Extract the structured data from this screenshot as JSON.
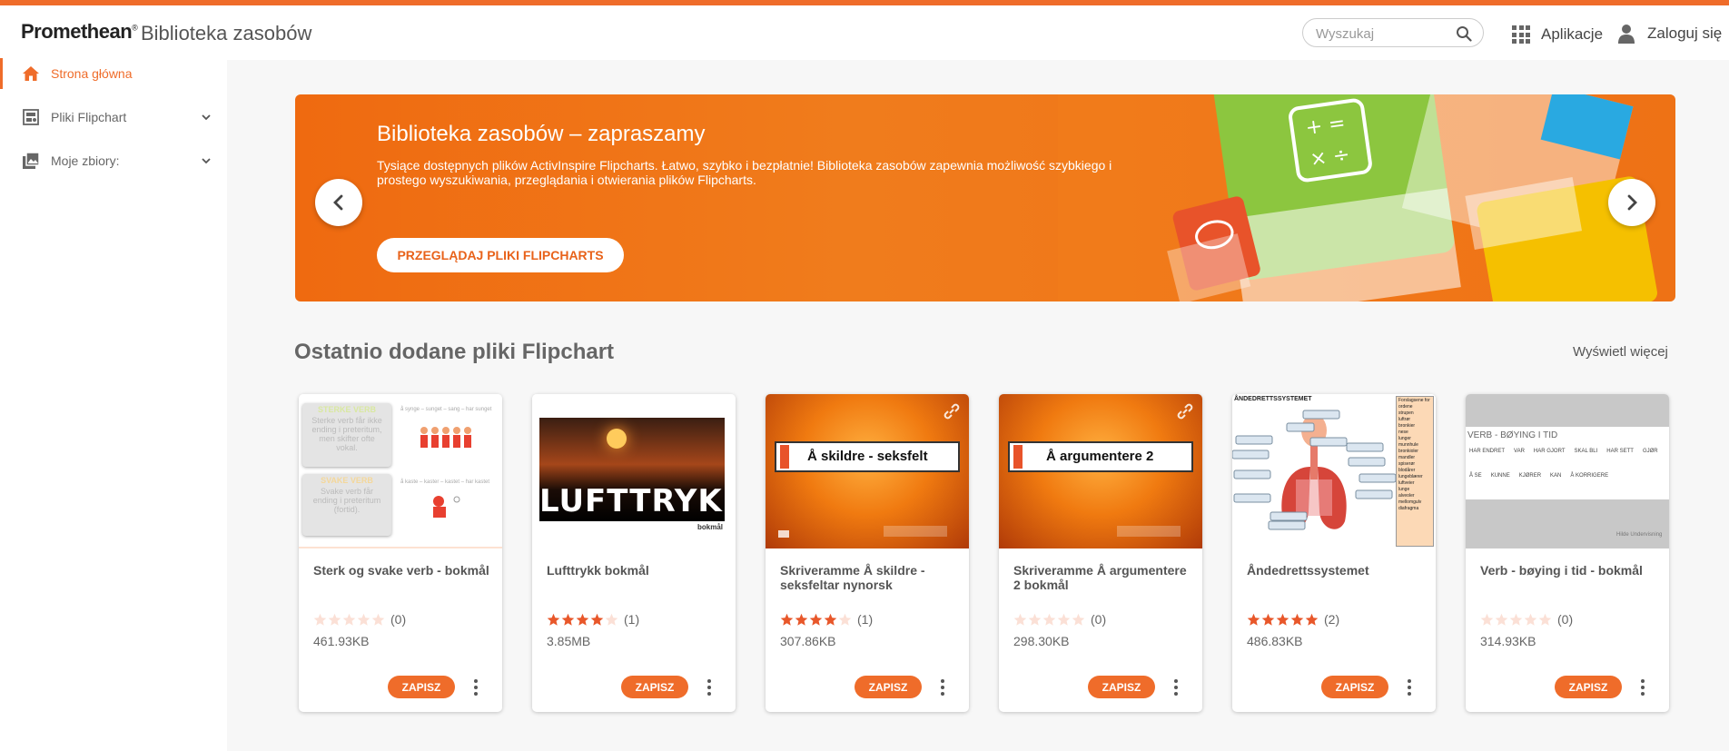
{
  "header": {
    "brand": "Promethean",
    "brand_mark": "®",
    "app_name": "Biblioteka zasobów",
    "search_placeholder": "Wyszukaj",
    "apps_label": "Aplikacje",
    "login_label": "Zaloguj się",
    "accent_color": "#ef6c2a"
  },
  "sidebar": {
    "items": [
      {
        "label": "Strona główna",
        "icon": "home-icon",
        "active": true
      },
      {
        "label": "Pliki Flipchart",
        "icon": "flipchart-icon",
        "expandable": true
      },
      {
        "label": "Moje zbiory:",
        "icon": "collections-icon",
        "expandable": true
      }
    ]
  },
  "banner": {
    "title": "Biblioteka zasobów – zapraszamy",
    "text": "Tysiące dostępnych plików ActivInspire Flipcharts. Łatwo, szybko i bezpłatnie! Biblioteka zasobów zapewnia możliwość szybkiego i prostego wyszukiwania, przeglądania i otwierania plików Flipcharts.",
    "cta": "PRZEGLĄDAJ PLIKI FLIPCHARTS"
  },
  "section": {
    "title": "Ostatnio dodane pliki Flipchart",
    "see_more": "Wyświetl więcej"
  },
  "cards": [
    {
      "title": "Sterk og svake verb - bokmål",
      "rating": 0,
      "count": "(0)",
      "size": "461.93KB",
      "save": "ZAPISZ",
      "thumb": "verbs"
    },
    {
      "title": "Lufttrykk bokmål",
      "rating": 4,
      "count": "(1)",
      "size": "3.85MB",
      "save": "ZAPISZ",
      "thumb": "lufttrykk"
    },
    {
      "title": "Skriveramme Å skildre - seksfeltar nynorsk",
      "rating": 4,
      "count": "(1)",
      "size": "307.86KB",
      "save": "ZAPISZ",
      "thumb": "skildre",
      "linked": true
    },
    {
      "title": "Skriveramme Å argumentere 2 bokmål",
      "rating": 0,
      "count": "(0)",
      "size": "298.30KB",
      "save": "ZAPISZ",
      "thumb": "argumentere",
      "linked": true
    },
    {
      "title": "Åndedrettssystemet",
      "rating": 5,
      "count": "(2)",
      "size": "486.83KB",
      "save": "ZAPISZ",
      "thumb": "anatomy"
    },
    {
      "title": "Verb - bøying i tid - bokmål",
      "rating": 0,
      "count": "(0)",
      "size": "314.93KB",
      "save": "ZAPISZ",
      "thumb": "verb-tid"
    }
  ],
  "thumb_text": {
    "verbs": {
      "box1": "STERKE VERB",
      "box1_body": "Sterke verb får ikke ending i preteritum, men skifter ofte vokal.",
      "line1": "å synge – sunget – sang – har sunget",
      "box2": "SVAKE VERB",
      "box2_body": "Svake verb får ending i preteritum (fortid).",
      "line2": "å kaste – kaster – kastet – har kastet"
    },
    "lufttrykk": {
      "word": "LUFTTRYKK",
      "lang": "bokmål"
    },
    "skildre": {
      "label": "Å skildre - seksfelt"
    },
    "argumentere": {
      "label": "Å argumentere 2"
    },
    "anatomy": {
      "heading": "ÅNDEDRETTSSYSTEMET",
      "terms": [
        "Forslagsene for ordene",
        "strupen",
        "luftrør",
        "bronkier",
        "nese",
        "lunger",
        "munnhule",
        "bronkioler",
        "mandler",
        "spiserør",
        "blodårer",
        "lungeblærer",
        "luftveier",
        "lunge",
        "alveoler",
        "mellomgulv",
        "diafragma"
      ]
    },
    "verb-tid": {
      "heading": "VERB - BØYING I TID",
      "words": [
        "HAR ENDRET",
        "VAR",
        "HAR GJORT",
        "SKAL BLI",
        "HAR SETT",
        "GJØR",
        "Å SE",
        "KUNNE",
        "KJØRER",
        "KAN",
        "Å KORRIGERE"
      ],
      "footer": "Hilde Undervisning"
    }
  }
}
